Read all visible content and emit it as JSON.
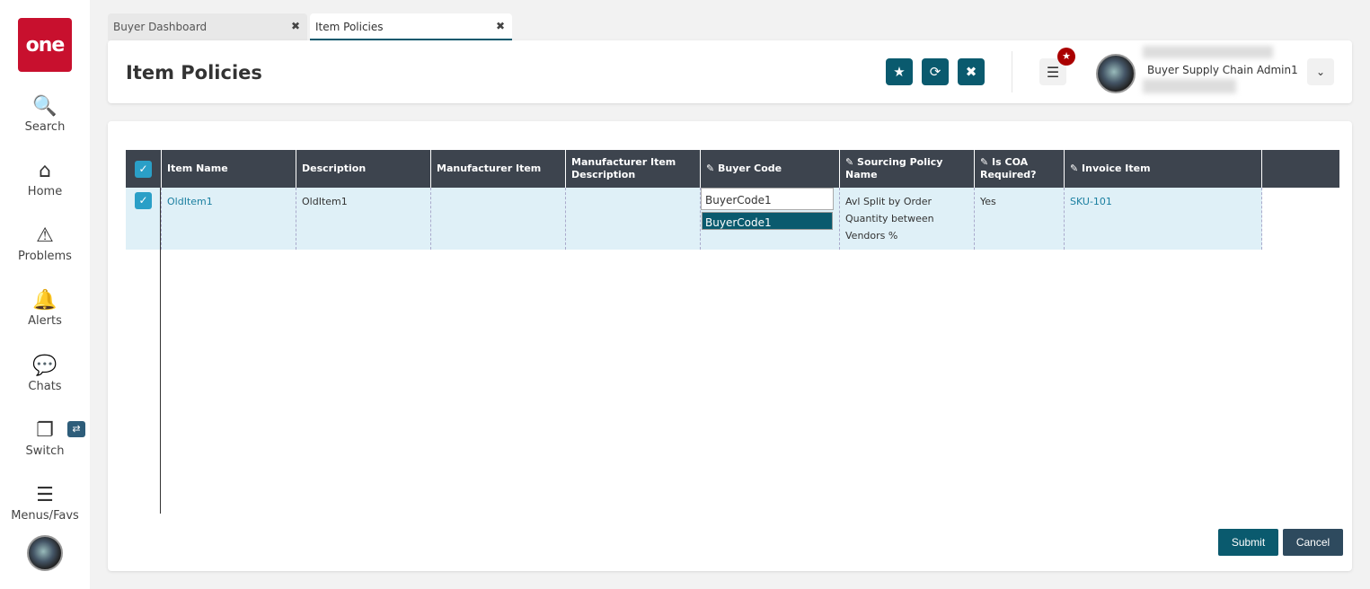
{
  "sidebar": {
    "logo": "one",
    "items": [
      {
        "label": "Search",
        "icon": "search-icon"
      },
      {
        "label": "Home",
        "icon": "home-icon"
      },
      {
        "label": "Problems",
        "icon": "warning-icon"
      },
      {
        "label": "Alerts",
        "icon": "bell-icon"
      },
      {
        "label": "Chats",
        "icon": "chat-icon"
      },
      {
        "label": "Switch",
        "icon": "switch-icon"
      },
      {
        "label": "Menus/Favs",
        "icon": "menu-icon"
      }
    ]
  },
  "tabs": [
    {
      "label": "Buyer Dashboard"
    },
    {
      "label": "Item Policies",
      "active": true
    }
  ],
  "header": {
    "title": "Item Policies",
    "user_role": "Buyer Supply Chain Admin1"
  },
  "table": {
    "columns": [
      "Item Name",
      "Description",
      "Manufacturer Item",
      "Manufacturer Item Description",
      "Buyer Code",
      "Sourcing Policy Name",
      "Is COA Required?",
      "Invoice Item"
    ],
    "rows": [
      {
        "item_name": "OldItem1",
        "description": "OldItem1",
        "manufacturer_item": "",
        "manufacturer_item_description": "",
        "buyer_code": "BuyerCode1",
        "buyer_code_suggestion": "BuyerCode1",
        "sourcing_policy_name": "Avl Split by Order Quantity between Vendors %",
        "is_coa_required": "Yes",
        "invoice_item": "SKU-101"
      }
    ]
  },
  "actions": {
    "submit": "Submit",
    "cancel": "Cancel"
  },
  "colors": {
    "accent": "#0a5a6e",
    "header_bg": "#3d444e",
    "row_bg": "#dff0f7",
    "logo": "#c8102e"
  }
}
